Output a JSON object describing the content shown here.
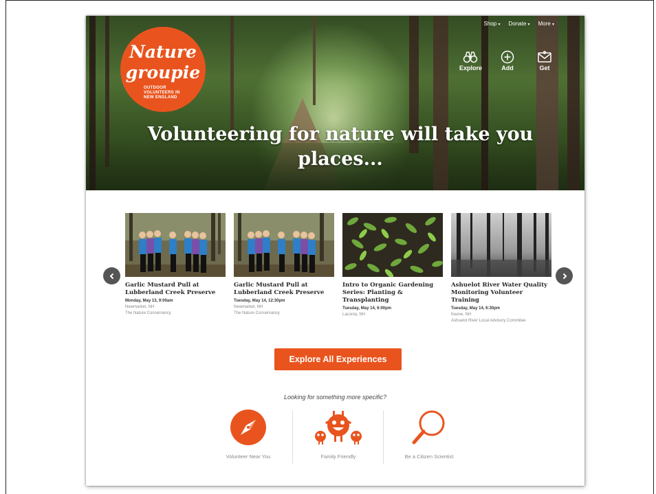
{
  "nav": {
    "links": [
      {
        "label": "Shop",
        "arrow": "▾"
      },
      {
        "label": "Donate",
        "arrow": "▾"
      },
      {
        "label": "More",
        "arrow": "▾"
      }
    ],
    "icons": [
      {
        "label": "Explore",
        "icon": "binoculars-icon"
      },
      {
        "label": "Add",
        "icon": "plus-circle-icon"
      },
      {
        "label": "Get",
        "icon": "envelope-icon"
      }
    ]
  },
  "logo": {
    "line1": "Nature",
    "line2": "groupie",
    "tagline": "OUTDOOR VOLUNTEERS IN NEW ENGLAND"
  },
  "hero": {
    "headline": "Volunteering for nature will take you places..."
  },
  "events": [
    {
      "title": "Garlic Mustard Pull at Lubberland Creek Preserve",
      "date": "Monday, May 13, 9:00am",
      "location": "Newmarket, NH",
      "org": "The Nature Conservancy"
    },
    {
      "title": "Garlic Mustard Pull at Lubberland Creek Preserve",
      "date": "Tuesday, May 14, 12:30pm",
      "location": "Newmarket, NH",
      "org": "The Nature Conservancy"
    },
    {
      "title": "Intro to Organic Gardening Series: Planting & Transplanting",
      "date": "Tuesday, May 14, 6:00pm",
      "location": "Laconia, NH",
      "org": ""
    },
    {
      "title": "Ashuelot River Water Quality Monitoring Volunteer Training",
      "date": "Tuesday, May 14, 6:30pm",
      "location": "Keene, NH",
      "org": "Ashuelot River Local Advisory Commitee"
    }
  ],
  "cta": {
    "label": "Explore All Experiences"
  },
  "specific": {
    "prompt": "Looking for something more specific?",
    "items": [
      {
        "label": "Volunteer Near You",
        "icon": "compass-icon"
      },
      {
        "label": "Family Friendly",
        "icon": "family-monsters-icon"
      },
      {
        "label": "Be a Citizen Scientist",
        "icon": "magnifier-icon"
      }
    ]
  },
  "colors": {
    "accent": "#e9541e",
    "arrow": "#555555"
  }
}
